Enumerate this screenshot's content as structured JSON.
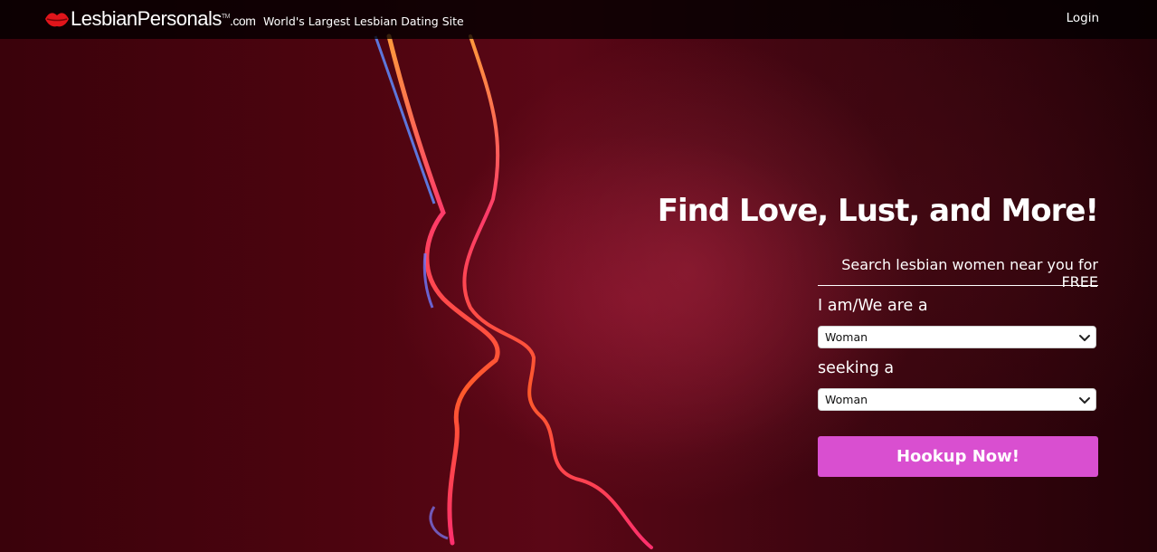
{
  "header": {
    "logo": {
      "text": "LesbianPersonals",
      "tm": "TM",
      "tld": ".com"
    },
    "tagline": "World's Largest Lesbian Dating Site",
    "login_label": "Login"
  },
  "hero": {
    "headline": "Find Love, Lust, and More!",
    "subheadline": "Search lesbian women near you for FREE"
  },
  "form": {
    "i_am_label": "I am/We are a",
    "i_am_value": "Woman",
    "seeking_label": "seeking a",
    "seeking_value": "Woman",
    "submit_label": "Hookup Now!"
  },
  "icons": [
    "lips-logo-icon",
    "chevron-down-icon"
  ],
  "colors": {
    "accent_button": "#d94fd0",
    "header_bg": "#000000",
    "logo_lips": "#e0151b"
  }
}
